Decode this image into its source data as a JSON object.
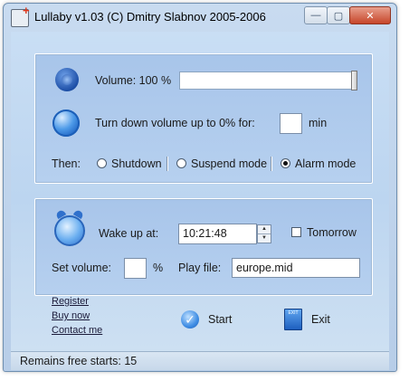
{
  "window": {
    "title": "Lullaby v1.03 (C) Dmitry Slabnov 2005-2006",
    "minimize_glyph": "—",
    "maximize_glyph": "▢",
    "close_glyph": "✕"
  },
  "volume": {
    "label": "Volume: 100 %",
    "level_percent": 100
  },
  "turn_down": {
    "label": "Turn down volume up to 0%  for:",
    "minutes_value": "",
    "unit": "min"
  },
  "then": {
    "label": "Then:",
    "options": [
      {
        "label": "Shutdown",
        "checked": false
      },
      {
        "label": "Suspend mode",
        "checked": false
      },
      {
        "label": "Alarm mode",
        "checked": true
      }
    ]
  },
  "alarm": {
    "wake_label": "Wake up at:",
    "time_value": "10:21:48",
    "tomorrow_label": "Tomorrow",
    "tomorrow_checked": false,
    "set_volume_label": "Set volume:",
    "set_volume_value": "",
    "percent_sign": "%",
    "play_file_label": "Play file:",
    "play_file_value": "europe.mid"
  },
  "links": {
    "register": "Register",
    "buy_now": "Buy now",
    "contact_me": "Contact me"
  },
  "buttons": {
    "start": "Start",
    "exit": "Exit",
    "exit_icon_text": "EXIT"
  },
  "status": {
    "text": "Remains free starts: 15"
  },
  "colors": {
    "accent": "#2f70cc",
    "panel": "#b6d0ef",
    "close_button": "#c6452a"
  }
}
